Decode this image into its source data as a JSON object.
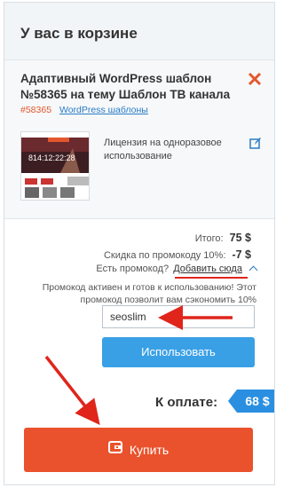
{
  "cart": {
    "title": "У вас в корзине"
  },
  "product": {
    "title": "Адаптивный WordPress шаблон №58365 на тему Шаблон ТВ канала",
    "id": "#58365",
    "category": "WordPress шаблоны",
    "thumbnail_text": "814:12:22:28",
    "license": "Лицензия на одноразовое использование"
  },
  "summary": {
    "total_label": "Итого:",
    "total_value": "75 $",
    "discount_label": "Скидка по промокоду 10%:",
    "discount_value": "-7 $",
    "promo_question": "Есть промокод?",
    "promo_link": "Добавить сюда",
    "promo_note": "Промокод активен и готов к использованию! Этот промокод позволит вам сэкономить 10%"
  },
  "promo": {
    "value": "seoslim",
    "apply_label": "Использовать"
  },
  "payment": {
    "label": "К оплате:",
    "amount": "68 $",
    "buy_label": "Купить"
  },
  "colors": {
    "accent_blue": "#39a0e6",
    "buy_orange": "#e9522c",
    "annotation_red": "#e0251b"
  }
}
